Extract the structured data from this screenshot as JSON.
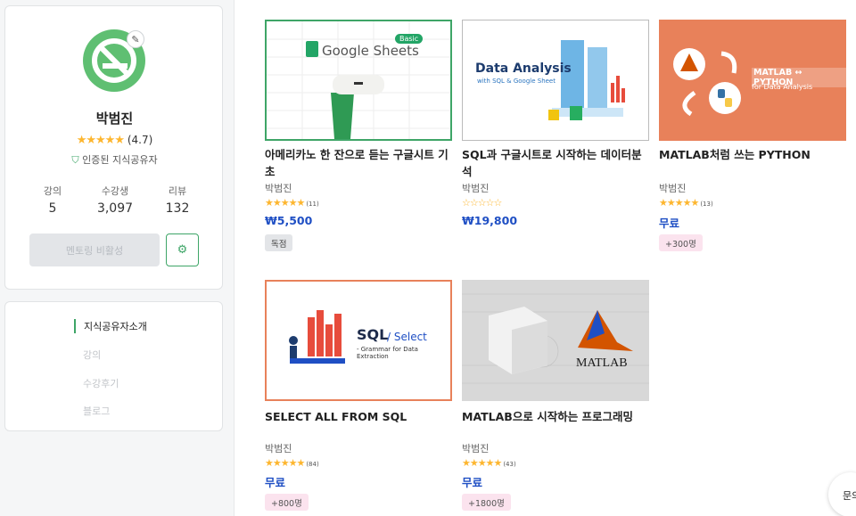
{
  "profile": {
    "name": "박범진",
    "rating": "(4.7)",
    "stars": "★★★★★",
    "verified_label": "인증된 지식공유자",
    "stats": [
      {
        "label": "강의",
        "value": "5"
      },
      {
        "label": "수강생",
        "value": "3,097"
      },
      {
        "label": "리뷰",
        "value": "132"
      }
    ],
    "mentoring_button": "멘토링 비활성",
    "settings_icon": "gear-icon",
    "edit_icon": "pencil-icon"
  },
  "menu": {
    "items": [
      {
        "label": "지식공유자소개",
        "active": true
      },
      {
        "label": "강의",
        "active": false
      },
      {
        "label": "수강후기",
        "active": false
      },
      {
        "label": "블로그",
        "active": false
      }
    ]
  },
  "courses": [
    {
      "title": "아메리카노 한 잔으로 듣는 구글시트 기초",
      "instructor": "박범진",
      "stars": "★★★★★",
      "review_count": "(11)",
      "price": "₩5,500",
      "badge": "독점",
      "thumb_text": "Google Sheets",
      "thumb_badge": "Basic"
    },
    {
      "title": "SQL과 구글시트로 시작하는 데이터분석",
      "instructor": "박범진",
      "stars": "☆☆☆☆☆",
      "review_count": "",
      "price": "₩19,800",
      "thumb_text": "Data Analysis",
      "thumb_sub": "with SQL & Google Sheet"
    },
    {
      "title": "MATLAB처럼 쓰는 PYTHON",
      "instructor": "박범진",
      "stars": "★★★★★",
      "review_count": "(13)",
      "price": "무료",
      "badge": "+300명",
      "thumb_text": "MATLAB ↔ PYTHON",
      "thumb_sub": "for Data Analysis"
    },
    {
      "title": "SELECT ALL FROM SQL",
      "instructor": "박범진",
      "stars": "★★★★★",
      "review_count": "(84)",
      "price": "무료",
      "badge": "+800명",
      "thumb_text": "SQL",
      "thumb_text2": "Select",
      "thumb_sub": "- Grammar for Data Extraction"
    },
    {
      "title": "MATLAB으로 시작하는 프로그래밍",
      "instructor": "박범진",
      "stars": "★★★★★",
      "review_count": "(43)",
      "price": "무료",
      "badge": "+1800명",
      "thumb_text": "MATLAB"
    }
  ],
  "chat": {
    "label": "문의"
  },
  "colors": {
    "accent_green": "#3ea567",
    "price_blue": "#1f4fc4",
    "star_yellow": "#fdb62f",
    "matlab_orange": "#e8815a"
  }
}
